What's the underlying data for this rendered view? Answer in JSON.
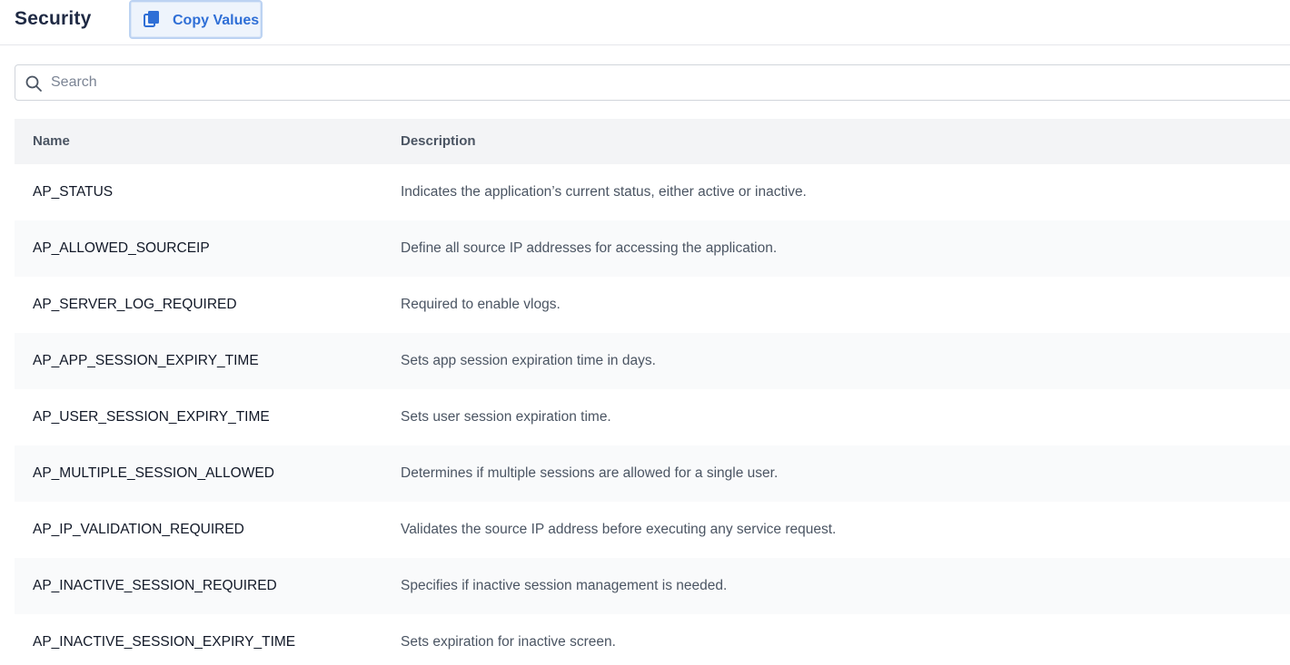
{
  "header": {
    "title": "Security",
    "copy_button_label": "Copy Values",
    "copy_icon": "copy-icon"
  },
  "search": {
    "placeholder": "Search",
    "value": "",
    "icon": "search-icon"
  },
  "table": {
    "columns": [
      "Name",
      "Description"
    ],
    "rows": [
      {
        "name": "AP_STATUS",
        "description": "Indicates the application’s current status, either active or inactive."
      },
      {
        "name": "AP_ALLOWED_SOURCEIP",
        "description": "Define all source IP addresses for accessing the application."
      },
      {
        "name": "AP_SERVER_LOG_REQUIRED",
        "description": "Required to enable vlogs."
      },
      {
        "name": "AP_APP_SESSION_EXPIRY_TIME",
        "description": "Sets app session expiration time in days."
      },
      {
        "name": "AP_USER_SESSION_EXPIRY_TIME",
        "description": "Sets user session expiration time."
      },
      {
        "name": "AP_MULTIPLE_SESSION_ALLOWED",
        "description": "Determines if multiple sessions are allowed for a single user."
      },
      {
        "name": "AP_IP_VALIDATION_REQUIRED",
        "description": "Validates the source IP address before executing any service request."
      },
      {
        "name": "AP_INACTIVE_SESSION_REQUIRED",
        "description": "Specifies if inactive session management is needed."
      },
      {
        "name": "AP_INACTIVE_SESSION_EXPIRY_TIME",
        "description": "Sets expiration for inactive screen."
      }
    ]
  },
  "colors": {
    "accent": "#2f6fd6",
    "header_bg": "#f3f4f6",
    "alt_row_bg": "#f9fafb"
  }
}
